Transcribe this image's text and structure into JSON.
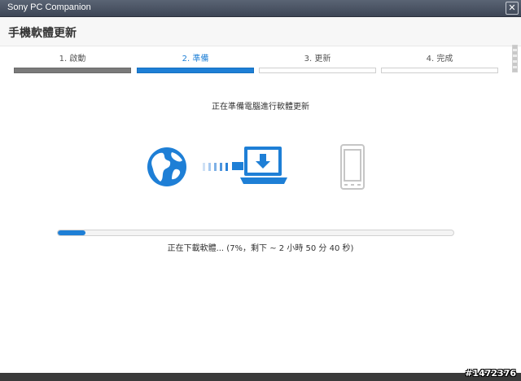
{
  "window": {
    "title": "Sony PC Companion",
    "close_glyph": "✕"
  },
  "header": {
    "title": "手機軟體更新"
  },
  "steps": [
    {
      "label": "1. 啟動",
      "state": "done"
    },
    {
      "label": "2. 準備",
      "state": "active"
    },
    {
      "label": "3. 更新",
      "state": "pending"
    },
    {
      "label": "4. 完成",
      "state": "pending"
    }
  ],
  "main": {
    "status_message": "正在準備電腦進行軟體更新",
    "illustration": {
      "icons": [
        "globe-icon",
        "transfer-dots-icon",
        "laptop-download-icon",
        "phone-icon"
      ]
    },
    "progress": {
      "percent": 7,
      "text": "正在下載軟體... (7%，剩下 ~ 2 小時 50 分 40 秒)"
    }
  },
  "colors": {
    "accent": "#1e7fd6",
    "done_bar": "#7a7a7a",
    "phone_gray": "#c6c6c6"
  },
  "watermark": "#1472376"
}
